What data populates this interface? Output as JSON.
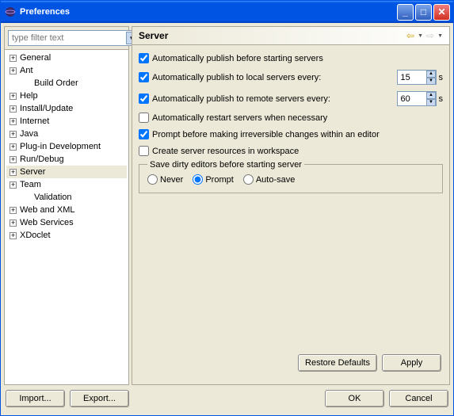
{
  "window": {
    "title": "Preferences"
  },
  "filter": {
    "placeholder": "type filter text"
  },
  "tree": [
    {
      "label": "General",
      "exp": true,
      "level": 0
    },
    {
      "label": "Ant",
      "exp": true,
      "level": 0
    },
    {
      "label": "Build Order",
      "exp": false,
      "level": 1
    },
    {
      "label": "Help",
      "exp": true,
      "level": 0
    },
    {
      "label": "Install/Update",
      "exp": true,
      "level": 0
    },
    {
      "label": "Internet",
      "exp": true,
      "level": 0
    },
    {
      "label": "Java",
      "exp": true,
      "level": 0
    },
    {
      "label": "Plug-in Development",
      "exp": true,
      "level": 0
    },
    {
      "label": "Run/Debug",
      "exp": true,
      "level": 0
    },
    {
      "label": "Server",
      "exp": true,
      "level": 0,
      "selected": true
    },
    {
      "label": "Team",
      "exp": true,
      "level": 0
    },
    {
      "label": "Validation",
      "exp": false,
      "level": 1
    },
    {
      "label": "Web and XML",
      "exp": true,
      "level": 0
    },
    {
      "label": "Web Services",
      "exp": true,
      "level": 0
    },
    {
      "label": "XDoclet",
      "exp": true,
      "level": 0
    }
  ],
  "page": {
    "title": "Server",
    "opts": {
      "auto_publish_start": "Automatically publish before starting servers",
      "auto_publish_local": "Automatically publish to local servers every:",
      "auto_publish_remote": "Automatically publish to remote servers every:",
      "auto_restart": "Automatically restart servers when necessary",
      "prompt_irreversible": "Prompt before making irreversible changes within an editor",
      "create_resources": "Create server resources in workspace"
    },
    "local_interval": "15",
    "remote_interval": "60",
    "unit": "s",
    "dirty": {
      "legend": "Save dirty editors before starting server",
      "never": "Never",
      "prompt": "Prompt",
      "autosave": "Auto-save"
    }
  },
  "buttons": {
    "restore": "Restore Defaults",
    "apply": "Apply",
    "import": "Import...",
    "export": "Export...",
    "ok": "OK",
    "cancel": "Cancel"
  }
}
